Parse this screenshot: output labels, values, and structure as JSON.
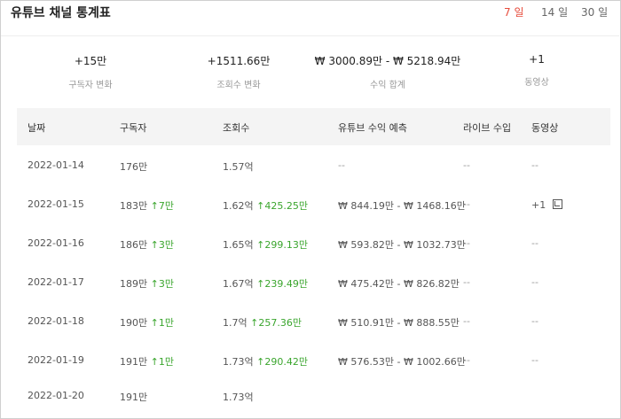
{
  "header": {
    "title": "유튜브 채널 통계표",
    "ranges": [
      "7 일",
      "14 일",
      "30 일"
    ],
    "active_range": "7 일"
  },
  "summary": [
    {
      "value": "+15만",
      "label": "구독자 변화"
    },
    {
      "value": "+1511.66만",
      "label": "조회수 변화"
    },
    {
      "value": "₩ 3000.89만 - ₩ 5218.94만",
      "label": "수익 합계"
    },
    {
      "value": "+1",
      "label": "동영상"
    }
  ],
  "table": {
    "columns": [
      "날짜",
      "구독자",
      "조회수",
      "유튜브 수익 예측",
      "라이브 수입",
      "동영상"
    ],
    "rows": [
      {
        "date": "2022-01-14",
        "subs": "176만",
        "subs_delta": "",
        "views": "1.57억",
        "views_delta": "",
        "revenue": "--",
        "live": "--",
        "videos": "--"
      },
      {
        "date": "2022-01-15",
        "subs": "183만",
        "subs_delta": "↑7만",
        "views": "1.62억",
        "views_delta": "↑425.25만",
        "revenue": "₩ 844.19만 - ₩ 1468.16만",
        "live": "--",
        "videos": "+1"
      },
      {
        "date": "2022-01-16",
        "subs": "186만",
        "subs_delta": "↑3만",
        "views": "1.65억",
        "views_delta": "↑299.13만",
        "revenue": "₩ 593.82만 - ₩ 1032.73만",
        "live": "--",
        "videos": "--"
      },
      {
        "date": "2022-01-17",
        "subs": "189만",
        "subs_delta": "↑3만",
        "views": "1.67억",
        "views_delta": "↑239.49만",
        "revenue": "₩ 475.42만 - ₩ 826.82만",
        "live": "--",
        "videos": "--"
      },
      {
        "date": "2022-01-18",
        "subs": "190만",
        "subs_delta": "↑1만",
        "views": "1.7억",
        "views_delta": "↑257.36만",
        "revenue": "₩ 510.91만 - ₩ 888.55만",
        "live": "--",
        "videos": "--"
      },
      {
        "date": "2022-01-19",
        "subs": "191만",
        "subs_delta": "↑1만",
        "views": "1.73억",
        "views_delta": "↑290.42만",
        "revenue": "₩ 576.53만 - ₩ 1002.66만",
        "live": "--",
        "videos": "--"
      },
      {
        "date": "2022-01-20",
        "subs": "191만",
        "subs_delta": "",
        "views": "1.73억",
        "views_delta": "",
        "revenue": "",
        "live": "",
        "videos": ""
      }
    ]
  },
  "colors": {
    "accent": "#e74c3c",
    "up": "#3aa52d",
    "header_bg": "#f4f4f4"
  },
  "icons": {
    "video_link": "external-link-icon"
  }
}
